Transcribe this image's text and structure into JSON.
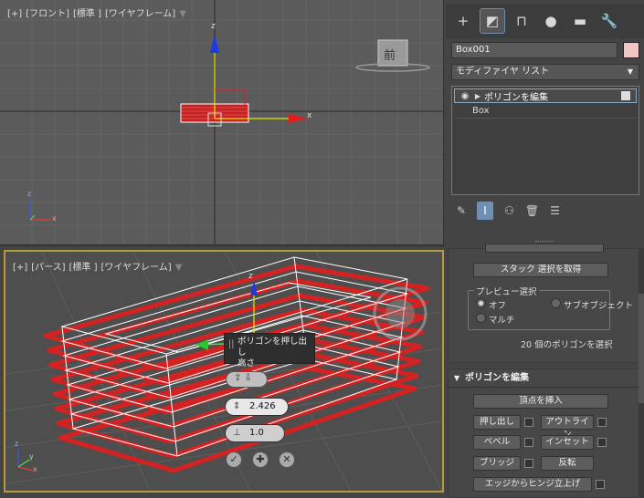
{
  "viewport_front": {
    "label_parts": [
      "[+]",
      "[フロント]",
      "[標準 ]",
      "[ワイヤフレーム]"
    ],
    "viewcube_label": "前",
    "axis_z": "z",
    "axis_x": "x"
  },
  "viewport_persp": {
    "label_parts": [
      "[+]",
      "[パース]",
      "[標準 ]",
      "[ワイヤフレーム]"
    ],
    "axis_z": "z",
    "axis_x": "x",
    "axis_y": "y"
  },
  "caddy": {
    "tooltip_line1": "ポリゴンを押し出し",
    "tooltip_line2": "高さ",
    "height_value": "2.426",
    "second_value": "1.0"
  },
  "panel": {
    "object_name": "Box001",
    "modifier_list": "モディファイヤ リスト",
    "stack_items": [
      "ポリゴンを編集",
      "Box"
    ],
    "get_stack_selection": "スタック 選択を取得",
    "preview_group_title": "プレビュー選択",
    "preview_options": [
      "オフ",
      "サブオブジェクト",
      "マルチ"
    ],
    "selection_info": "20 個のポリゴンを選択",
    "edit_poly_header": "ポリゴンを編集",
    "insert_vertex": "頂点を挿入",
    "extrude": "押し出し",
    "outline": "アウトライン",
    "bevel": "ベベル",
    "inset": "インセット",
    "bridge": "ブリッジ",
    "flip": "反転",
    "hinge_from_edge": "エッジからヒンジ立上げ"
  },
  "colors": {
    "selected_face": "#c62020",
    "wire": "#ffffff",
    "active_border": "#b59a3e",
    "swatch": "#f2c4c2"
  }
}
